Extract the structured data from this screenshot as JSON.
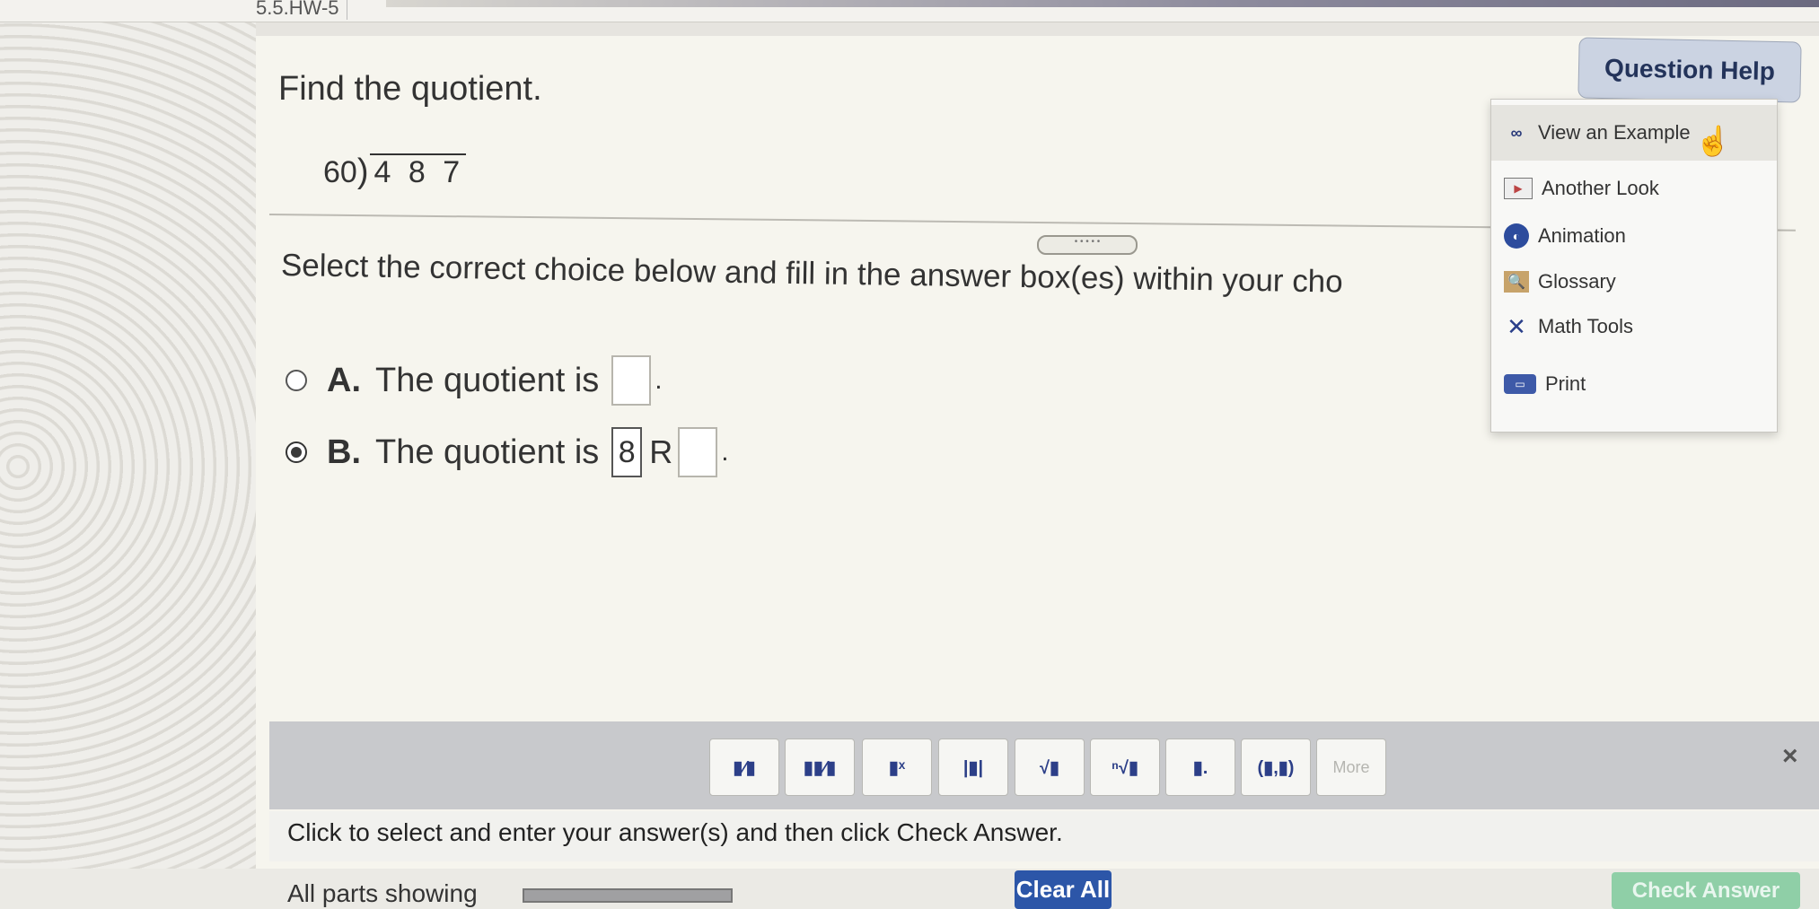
{
  "header": {
    "hw_title": "5.5.HW-5"
  },
  "question": {
    "title": "Find the quotient.",
    "divisor": "60",
    "dividend": "4 8 7",
    "instruction": "Select the correct choice below and fill in the answer box(es) within your cho"
  },
  "choices": [
    {
      "letter": "A.",
      "text": "The quotient is",
      "suffix": ".",
      "selected": false
    },
    {
      "letter": "B.",
      "text": "The quotient is",
      "value": "8",
      "r_label": "R",
      "suffix": ".",
      "selected": true
    }
  ],
  "help": {
    "button_label": "Question Help",
    "items": [
      {
        "label": "View an Example",
        "icon": "binoculars-icon"
      },
      {
        "label": "Another Look",
        "icon": "video-icon"
      },
      {
        "label": "Animation",
        "icon": "animation-icon"
      },
      {
        "label": "Glossary",
        "icon": "book-search-icon"
      },
      {
        "label": "Math Tools",
        "icon": "tools-icon"
      },
      {
        "label": "Print",
        "icon": "printer-icon"
      }
    ]
  },
  "toolbar": {
    "buttons": [
      {
        "name": "fraction",
        "glyph": "▮⁄▮"
      },
      {
        "name": "mixed-number",
        "glyph": "▮▮⁄▮"
      },
      {
        "name": "exponent",
        "glyph": "▮ˣ"
      },
      {
        "name": "absolute-value",
        "glyph": "|▮|"
      },
      {
        "name": "square-root",
        "glyph": "√▮"
      },
      {
        "name": "nth-root",
        "glyph": "ⁿ√▮"
      },
      {
        "name": "decimal",
        "glyph": "▮."
      },
      {
        "name": "ordered-pair",
        "glyph": "(▮,▮)"
      },
      {
        "name": "more",
        "glyph": "More"
      }
    ],
    "close": "×"
  },
  "status_text": "Click to select and enter your answer(s) and then click Check Answer.",
  "footer": {
    "parts_text": "All parts showing",
    "progress": 1.0,
    "clear_all": "Clear All",
    "check_answer": "Check Answer"
  }
}
